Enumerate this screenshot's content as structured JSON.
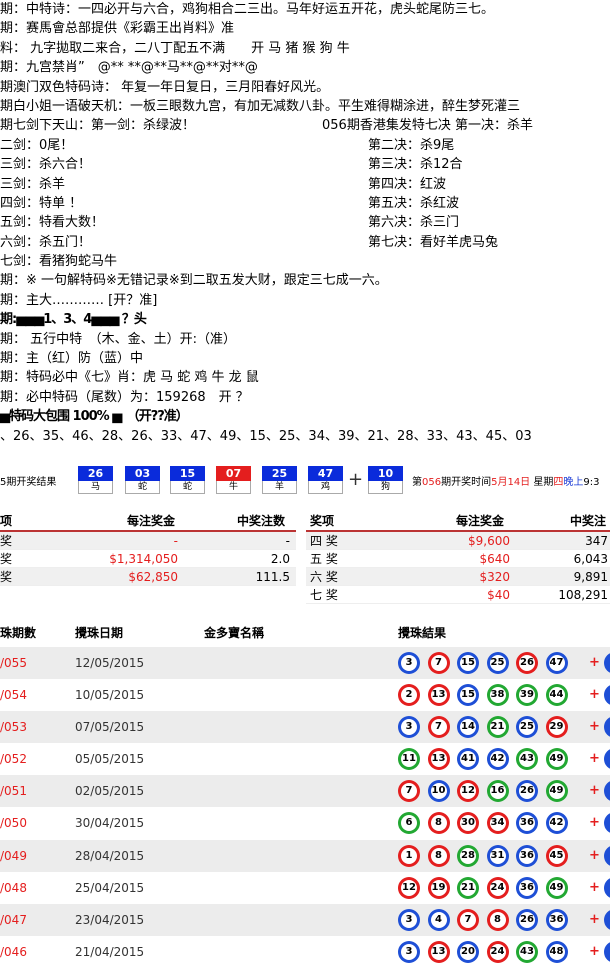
{
  "lines": [
    "期：中特诗：一四必开与六合，鸡狗相合二三出。马年好运五开花，虎头蛇尾防三七。",
    "期：赛馬會总部提供《彩霸王出肖料》准",
    "料： 九字拋取二来合，二八丁配五不满　　开 马 猪 猴 狗 牛",
    "期：九宫禁肖”　@** **@**马**@**对**@",
    "期澳门双色特码诗： 年复一年日复日，三月阳春好风光。",
    "期白小姐一语破天机：一板三眼数九宫，有加无减数八卦。平生难得糊涂进，醉生梦死灌三"
  ],
  "sword_header": {
    "left": "期七剑下天山：第一剑：杀绿波！",
    "right": "056期香港集发特七决 第一决：杀羊"
  },
  "sword_rows": [
    {
      "left": "二剑：0尾！",
      "right": "第二决：杀9尾"
    },
    {
      "left": "三剑：杀六合！",
      "right": "第三决：杀12合"
    },
    {
      "left": "三剑：杀羊",
      "right": "第四决：红波"
    },
    {
      "left": "四剑：特单 ！",
      "right": "第五决：杀红波"
    },
    {
      "left": "五剑：特看大数！",
      "right": "第六决：杀三门"
    },
    {
      "left": "六剑：杀五门！",
      "right": "第七决：看好羊虎马兔"
    }
  ],
  "lines2": [
    "七剑：看猪狗蛇马牛",
    "期：※ 一句解特码※无错记录※到二取五发大财，跟定三七成一六。",
    "期：主大………… [开？准]",
    "期:▅▅▅1、3、4▅▅▅ ？头",
    "期： 五行中特　（木、金、土）开:（准）",
    "期：主（红）防（蓝）中",
    "期：特码必中《七》肖：虎 马 蛇 鸡 牛 龙 鼠",
    "期：必中特码（尾数）为：159268　开 ？",
    "▅特码大包围 100% ▅　（开??准）",
    "、26、35、46、28、26、33、47、49、15、25、34、39、21、28、33、43、45、03"
  ],
  "draw": {
    "title": "5期开奖结果",
    "balls": [
      {
        "num": "26",
        "zodiac": "马",
        "color": "blue"
      },
      {
        "num": "03",
        "zodiac": "蛇",
        "color": "blue"
      },
      {
        "num": "15",
        "zodiac": "蛇",
        "color": "blue"
      },
      {
        "num": "07",
        "zodiac": "牛",
        "color": "red"
      },
      {
        "num": "25",
        "zodiac": "羊",
        "color": "blue"
      },
      {
        "num": "47",
        "zodiac": "鸡",
        "color": "blue"
      }
    ],
    "plus": "+",
    "special": {
      "num": "10",
      "zodiac": "狗",
      "color": "blue"
    },
    "info_pre": "第",
    "info_issue": "056",
    "info_mid": "期开奖时间",
    "info_date": "5月14日",
    "info_week_pre": "星期",
    "info_week": "四",
    "info_night": "晚上",
    "info_time": "9:3"
  },
  "prize_left": {
    "headers": [
      "项",
      "每注奖金",
      "中奖注数"
    ],
    "rows": [
      {
        "name": "奖",
        "amount": "-",
        "count": "-"
      },
      {
        "name": "奖",
        "amount": "$1,314,050",
        "count": "2.0"
      },
      {
        "name": "奖",
        "amount": "$62,850",
        "count": "111.5"
      }
    ]
  },
  "prize_right": {
    "headers": [
      "奖项",
      "每注奖金",
      "中奖注"
    ],
    "rows": [
      {
        "name": "四 奖",
        "amount": "$9,600",
        "count": "347"
      },
      {
        "name": "五 奖",
        "amount": "$640",
        "count": "6,043"
      },
      {
        "name": "六 奖",
        "amount": "$320",
        "count": "9,891"
      },
      {
        "name": "七 奖",
        "amount": "$40",
        "count": "108,291"
      }
    ]
  },
  "history": {
    "headers": [
      "珠期數",
      "攪珠日期",
      "金多寶名稱",
      "攪珠結果"
    ],
    "rows": [
      {
        "no": "/055",
        "date": "12/05/2015",
        "balls": [
          "3",
          "7",
          "15",
          "25",
          "26",
          "47"
        ],
        "colors": [
          "blue",
          "red",
          "blue",
          "blue",
          "red",
          "blue"
        ],
        "plus": "+"
      },
      {
        "no": "/054",
        "date": "10/05/2015",
        "balls": [
          "2",
          "13",
          "15",
          "38",
          "39",
          "44"
        ],
        "colors": [
          "red",
          "red",
          "blue",
          "green",
          "green",
          "green"
        ],
        "plus": "+"
      },
      {
        "no": "/053",
        "date": "07/05/2015",
        "balls": [
          "3",
          "7",
          "14",
          "21",
          "25",
          "29"
        ],
        "colors": [
          "blue",
          "red",
          "blue",
          "green",
          "blue",
          "red"
        ],
        "plus": "+"
      },
      {
        "no": "/052",
        "date": "05/05/2015",
        "balls": [
          "11",
          "13",
          "41",
          "42",
          "43",
          "49"
        ],
        "colors": [
          "green",
          "red",
          "blue",
          "blue",
          "green",
          "green"
        ],
        "plus": "+"
      },
      {
        "no": "/051",
        "date": "02/05/2015",
        "balls": [
          "7",
          "10",
          "12",
          "16",
          "26",
          "49"
        ],
        "colors": [
          "red",
          "blue",
          "red",
          "green",
          "blue",
          "green"
        ],
        "plus": "+"
      },
      {
        "no": "/050",
        "date": "30/04/2015",
        "balls": [
          "6",
          "8",
          "30",
          "34",
          "36",
          "42"
        ],
        "colors": [
          "green",
          "red",
          "red",
          "red",
          "blue",
          "blue"
        ],
        "plus": "+"
      },
      {
        "no": "/049",
        "date": "28/04/2015",
        "balls": [
          "1",
          "8",
          "28",
          "31",
          "36",
          "45"
        ],
        "colors": [
          "red",
          "red",
          "green",
          "blue",
          "blue",
          "red"
        ],
        "plus": "+"
      },
      {
        "no": "/048",
        "date": "25/04/2015",
        "balls": [
          "12",
          "19",
          "21",
          "24",
          "36",
          "49"
        ],
        "colors": [
          "red",
          "red",
          "green",
          "red",
          "blue",
          "green"
        ],
        "plus": "+"
      },
      {
        "no": "/047",
        "date": "23/04/2015",
        "balls": [
          "3",
          "4",
          "7",
          "8",
          "26",
          "36"
        ],
        "colors": [
          "blue",
          "blue",
          "red",
          "red",
          "blue",
          "blue"
        ],
        "plus": "+"
      },
      {
        "no": "/046",
        "date": "21/04/2015",
        "balls": [
          "3",
          "13",
          "20",
          "24",
          "43",
          "48"
        ],
        "colors": [
          "blue",
          "red",
          "blue",
          "red",
          "green",
          "blue"
        ],
        "plus": "+"
      }
    ]
  }
}
